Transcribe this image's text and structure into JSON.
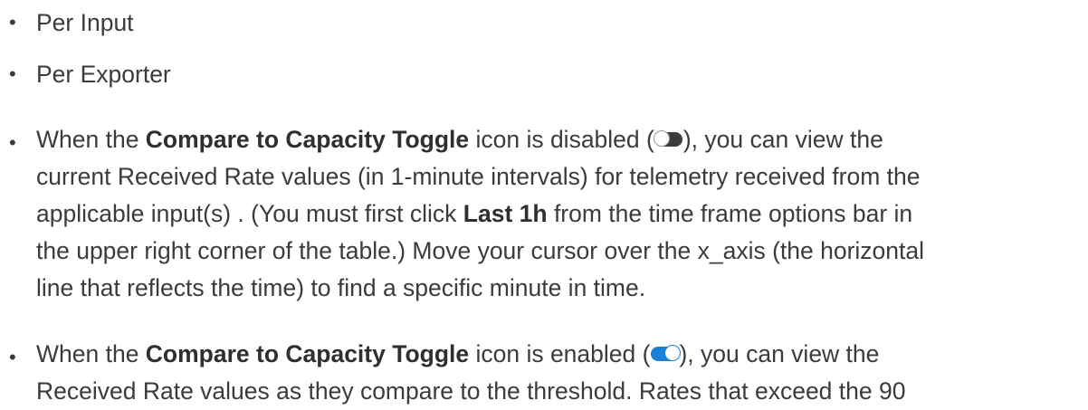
{
  "list": {
    "bullet_glyph": "•",
    "item1": {
      "text": "Per Input"
    },
    "item2": {
      "text": "Per Exporter"
    },
    "item3": {
      "l1_a": "When the ",
      "l1_b": "Compare to Capacity Toggle",
      "l1_c": " icon is disabled (",
      "l1_d": "), you can view the",
      "l2": "current Received Rate values (in 1-minute intervals) for telemetry received from the",
      "l3_a": "applicable input(s) . (You must first click ",
      "l3_b": "Last 1h",
      "l3_c": " from the time frame options bar in",
      "l4": "the upper right corner of the table.) Move your cursor over the x_axis (the horizontal",
      "l5": "line that reflects the time) to find a specific minute in time."
    },
    "item4": {
      "l1_a": "When the ",
      "l1_b": "Compare to Capacity Toggle",
      "l1_c": " icon is enabled (",
      "l1_d": "), you can view the",
      "l2": "Received Rate values as they compare to the threshold. Rates that exceed the 90"
    }
  },
  "icons": {
    "toggle_disabled": "toggle-off-icon",
    "toggle_enabled": "toggle-on-icon"
  },
  "colors": {
    "text": "#3b3b3b",
    "toggle_off": "#3c3c3c",
    "toggle_on": "#1c7fd6"
  }
}
